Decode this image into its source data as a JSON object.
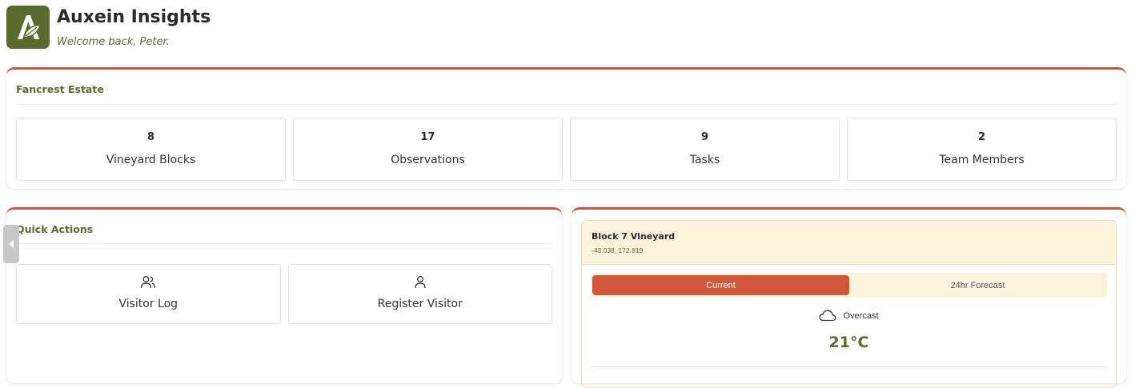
{
  "app": {
    "title": "Auxein Insights",
    "welcome": "Welcome back, Peter."
  },
  "estate": {
    "title": "Fancrest Estate",
    "stats": [
      {
        "value": "8",
        "label": "Vineyard Blocks"
      },
      {
        "value": "17",
        "label": "Observations"
      },
      {
        "value": "9",
        "label": "Tasks"
      },
      {
        "value": "2",
        "label": "Team Members"
      }
    ]
  },
  "quick_actions": {
    "title": "Quick Actions",
    "items": [
      {
        "label": "Visitor Log",
        "icon": "users-icon"
      },
      {
        "label": "Register Visitor",
        "icon": "user-icon"
      }
    ]
  },
  "weather": {
    "block_name": "Block 7 Vineyard",
    "coords": "-43.038, 172.819",
    "tabs": [
      "Current",
      "24hr Forecast"
    ],
    "active_tab": "Current",
    "condition": "Overcast",
    "condition_icon": "cloud-icon",
    "temperature": "21°C"
  },
  "colors": {
    "accent": "#c9593a",
    "brand": "#5b6b2f",
    "cream": "#fbf3dc"
  }
}
